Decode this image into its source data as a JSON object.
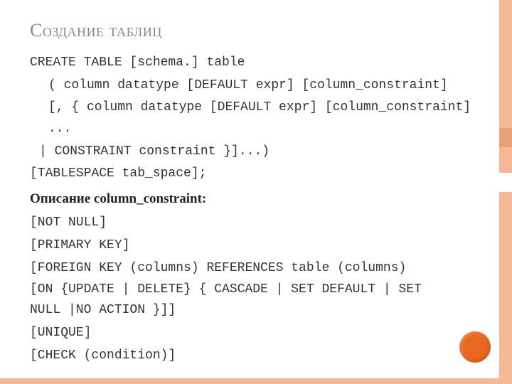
{
  "title": "Создание таблиц",
  "lines": {
    "l1": "CREATE TABLE [schema.] table",
    "l2": "( column datatype [DEFAULT expr] [column_constraint]",
    "l3": "[, { column datatype [DEFAULT expr] [column_constraint] ...",
    "l4": "| CONSTRAINT constraint }]...)",
    "l5": "[TABLESPACE tab_space];",
    "l6": "Описание column_constraint:",
    "l7": "[NOT NULL]",
    "l8": "[PRIMARY KEY]",
    "l9": "[FOREIGN KEY (columns) REFERENCES table (columns) [ON {UPDATE | DELETE} { CASCADE | SET DEFAULT | SET NULL |NO ACTION }]]",
    "l10": "[UNIQUE]",
    "l11": "[CHECK (condition)]"
  }
}
